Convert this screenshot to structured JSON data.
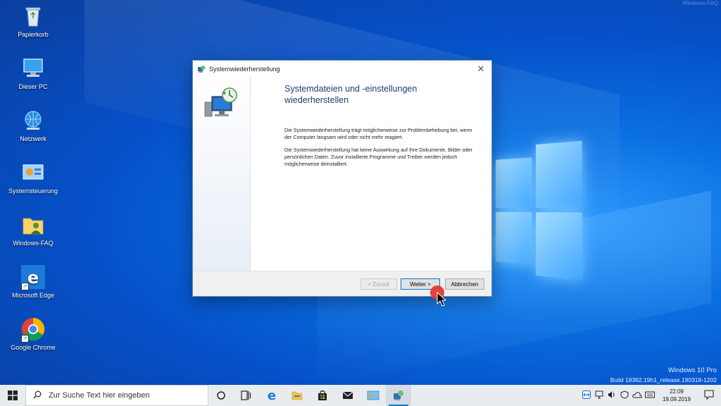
{
  "desktop": {
    "icons": [
      {
        "label": "Papierkorb",
        "icon": "recycle-bin-icon"
      },
      {
        "label": "Dieser PC",
        "icon": "computer-icon"
      },
      {
        "label": "Netzwerk",
        "icon": "network-icon"
      },
      {
        "label": "Systemsteuerung",
        "icon": "control-panel-icon"
      },
      {
        "label": "Windows-FAQ",
        "icon": "folder-user-icon"
      },
      {
        "label": "Microsoft Edge",
        "icon": "edge-icon"
      },
      {
        "label": "Google Chrome",
        "icon": "chrome-icon"
      }
    ],
    "corner_text": "Windows-FAQ",
    "version_line1": "Windows 10 Pro",
    "version_line2": "Build 18362.19h1_release.190318-1202"
  },
  "dialog": {
    "title": "Systemwiederherstellung",
    "heading": "Systemdateien und -einstellungen wiederherstellen",
    "para1": "Die Systemwiederherstellung trägt möglicherweise zur Problembehebung bei, wenn der Computer langsam wird oder nicht mehr reagiert.",
    "para2": "Die Systemwiederherstellung hat keine Auswirkung auf Ihre Dokumente, Bilder oder persönlichen Daten. Zuvor installierte Programme und Treiber werden jedoch möglicherweise deinstalliert.",
    "back_label": "< Zurück",
    "next_label": "Weiter >",
    "cancel_label": "Abbrechen",
    "close_glyph": "✕"
  },
  "taskbar": {
    "search_placeholder": "Zur Suche Text hier eingeben",
    "time": "22:09",
    "date": "19.09.2019"
  },
  "colors": {
    "accent": "#0078d7",
    "heading": "#1a3e72"
  }
}
